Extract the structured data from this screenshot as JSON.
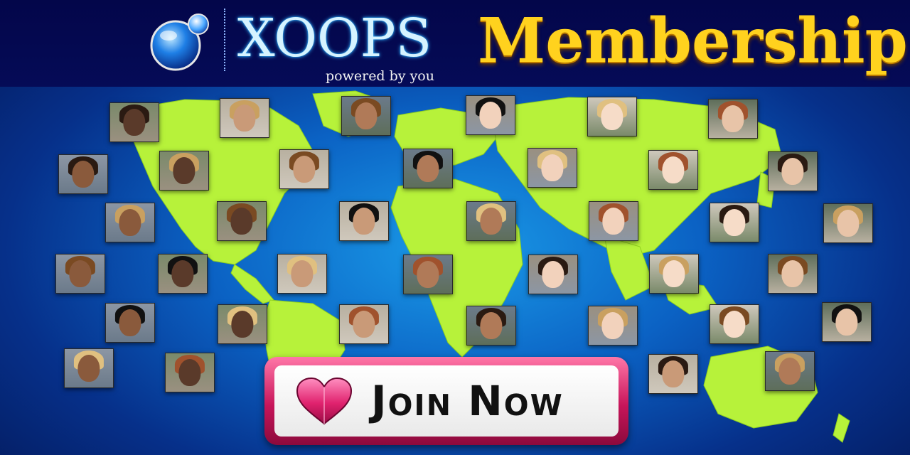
{
  "logo": {
    "brand": "XOOPS",
    "tagline": "powered by you",
    "icon": "xoops-orb-logo"
  },
  "headline": "Membership",
  "cta": {
    "label": "Join Now",
    "icon": "heart-icon"
  },
  "colors": {
    "header_bg": "#050b57",
    "ocean": "#0b62c4",
    "land": "#b7f23a",
    "headline": "#ffd21e",
    "cta_border": "#c7155a",
    "heart": "#e0226e"
  },
  "background": {
    "description_icon": "world-map"
  }
}
